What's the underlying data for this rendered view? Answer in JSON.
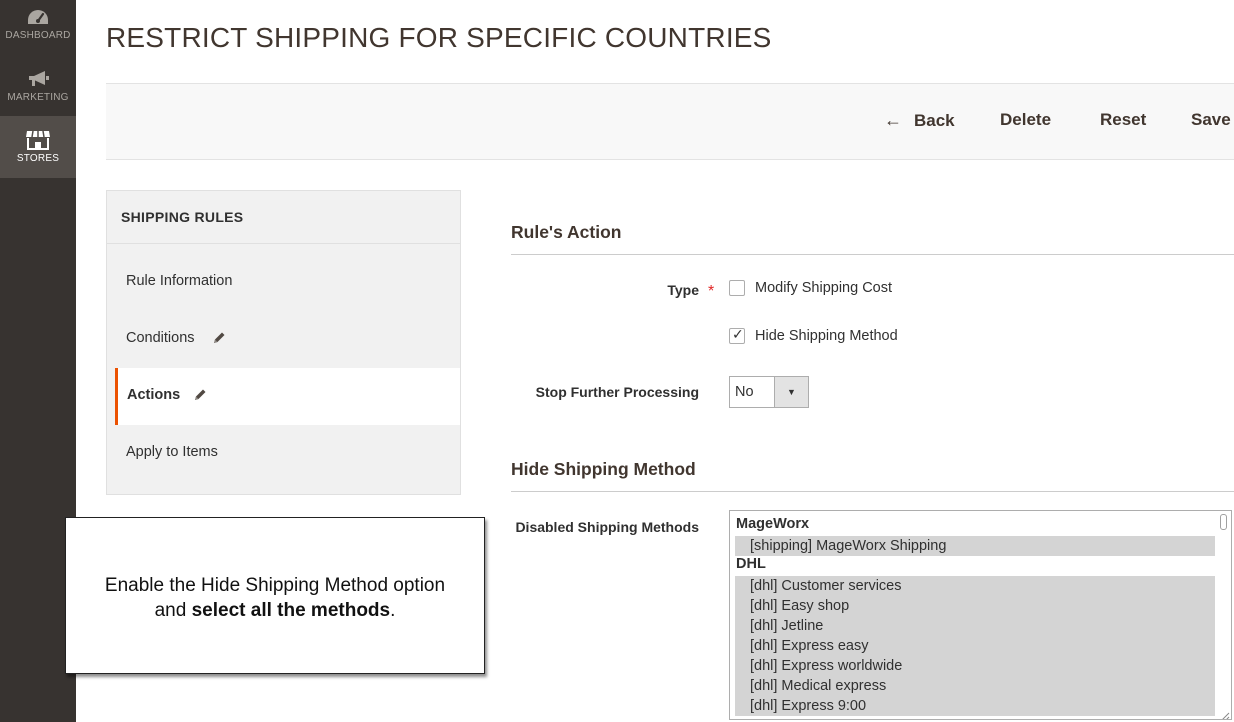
{
  "nav": {
    "items": [
      {
        "label": "DASHBOARD",
        "icon": "dashboard-gauge-icon"
      },
      {
        "label": "MARKETING",
        "icon": "megaphone-icon"
      },
      {
        "label": "STORES",
        "icon": "store-icon"
      }
    ]
  },
  "page": {
    "title": "RESTRICT SHIPPING FOR SPECIFIC COUNTRIES"
  },
  "actions": {
    "back": "Back",
    "delete": "Delete",
    "reset": "Reset",
    "save": "Save"
  },
  "tabs": {
    "header": "SHIPPING RULES",
    "items": [
      {
        "label": "Rule Information"
      },
      {
        "label": "Conditions"
      },
      {
        "label": "Actions"
      },
      {
        "label": "Apply to Items"
      }
    ]
  },
  "rule_action": {
    "title": "Rule's Action",
    "type_label": "Type",
    "required_mark": "*",
    "options": [
      {
        "label": "Modify Shipping Cost",
        "checked": false
      },
      {
        "label": "Hide Shipping Method",
        "checked": true
      }
    ],
    "stop_label": "Stop Further Processing",
    "stop_value": "No"
  },
  "hide_method": {
    "title": "Hide Shipping Method",
    "disabled_label": "Disabled Shipping Methods",
    "groups": [
      {
        "name": "MageWorx",
        "options": [
          "[shipping] MageWorx Shipping"
        ]
      },
      {
        "name": "DHL",
        "options": [
          "[dhl] Customer services",
          "[dhl] Easy shop",
          "[dhl] Jetline",
          "[dhl] Express easy",
          "[dhl] Express worldwide",
          "[dhl] Medical express",
          "[dhl] Express 9:00"
        ]
      }
    ]
  },
  "callout": {
    "line1": "Enable the Hide Shipping Method option",
    "line2_pre": "and ",
    "line2_bold": "select all the methods",
    "line2_post": "."
  },
  "colors": {
    "nav_bg": "#373330",
    "nav_active": "#524d49",
    "accent": "#eb5202",
    "required": "#e22626"
  }
}
